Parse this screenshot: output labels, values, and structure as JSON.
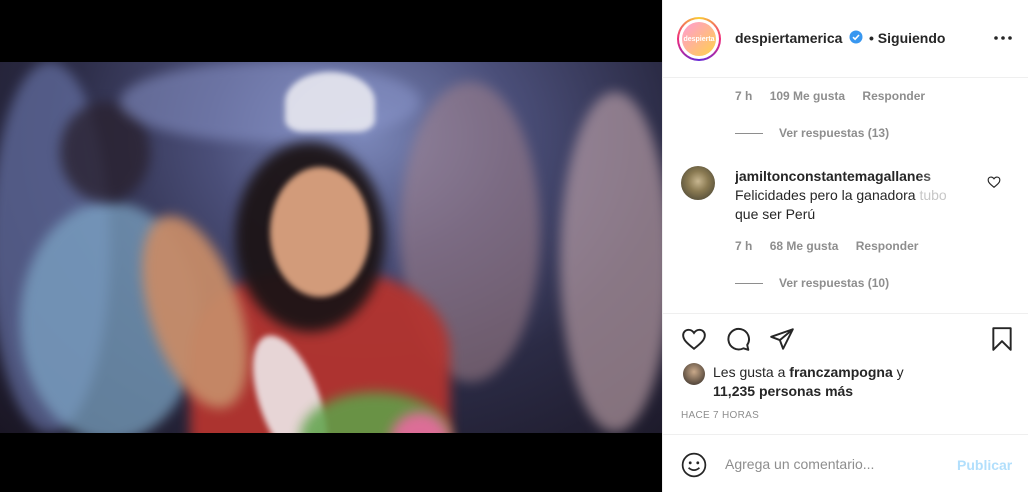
{
  "post": {
    "username": "despiertamerica",
    "follow_status": "• Siguiendo",
    "logo_text": "despierta"
  },
  "comments": [
    {
      "time": "7 h",
      "likes": "109 Me gusta",
      "reply": "Responder",
      "view_replies": "Ver respuestas (13)"
    },
    {
      "username": "jamiltonconstantemagallanes",
      "text_main": "Felicidades pero la ganadora ",
      "text_faded": "tubo",
      "text_line2": "que ser Perú",
      "time": "7 h",
      "likes": "68 Me gusta",
      "reply": "Responder",
      "view_replies": "Ver respuestas (10)"
    }
  ],
  "likes_summary": {
    "prefix": "Les gusta a ",
    "user": "franczampogna",
    "suffix": " y",
    "count": "11,235 personas más"
  },
  "timestamp": "HACE 7 HORAS",
  "composer": {
    "placeholder": "Agrega un comentario...",
    "publish": "Publicar"
  },
  "colors": {
    "verified": "#3897f0",
    "publish_disabled": "#b2dffc"
  }
}
